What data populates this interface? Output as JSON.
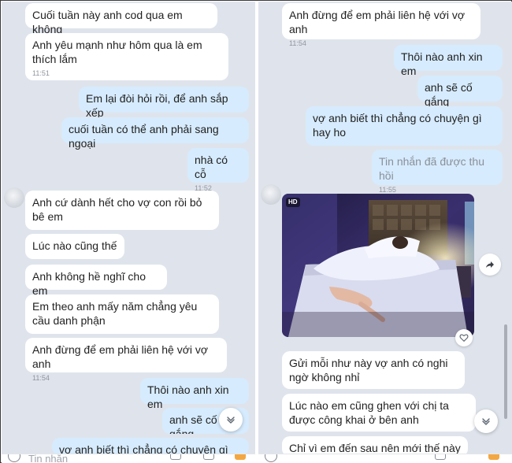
{
  "left_panel": {
    "messages": [
      {
        "text": "Cuối tuần này anh cod qua em không",
        "time": ""
      },
      {
        "text": "Anh yêu mạnh như hôm qua là em thích lắm",
        "time": "11:51"
      },
      {
        "text": "Em lại đòi hỏi rồi, để anh sắp xếp",
        "time": ""
      },
      {
        "text": "cuối tuần có thể anh phải sang ngoại",
        "time": ""
      },
      {
        "text": "nhà có cỗ",
        "time": "11:52"
      },
      {
        "text": "Anh cứ dành hết cho vợ con rồi bỏ bê em",
        "time": ""
      },
      {
        "text": "Lúc nào cũng thế",
        "time": ""
      },
      {
        "text": "Anh không hề nghĩ cho em",
        "time": ""
      },
      {
        "text": "Em theo anh mấy năm chẳng yêu cầu danh phận",
        "time": ""
      },
      {
        "text": "Anh đừng để em phải liên hệ với vợ anh",
        "time": "11:54"
      },
      {
        "text": "Thôi nào anh xin em",
        "time": ""
      },
      {
        "text": "anh sẽ cố gắng",
        "time": ""
      },
      {
        "text": "vợ anh biết thì chẳng có chuyện gì hay ho",
        "time": ""
      }
    ],
    "input_placeholder": "Tin nhắn"
  },
  "right_panel": {
    "messages": [
      {
        "text": "Anh đừng để em phải liên hệ với vợ anh",
        "time": "11:54"
      },
      {
        "text": "Thôi nào anh xin em",
        "time": ""
      },
      {
        "text": "anh sẽ cố gắng",
        "time": ""
      },
      {
        "text": "vợ anh biết thì chẳng có chuyện gì hay ho",
        "time": ""
      },
      {
        "text": "Tin nhắn đã được thu hồi",
        "time": "11:55"
      },
      {
        "text": "Gửi mỗi như này vợ anh có nghi ngờ không nhỉ",
        "time": ""
      },
      {
        "text": "Lúc nào em cũng ghen với chị ta được công khai ở bên anh",
        "time": ""
      },
      {
        "text": "Chỉ vì em đến sau nên mới thế này à",
        "time": ""
      }
    ],
    "photo_badge": "HD"
  },
  "colors": {
    "chat_background": "#dfe4ec",
    "received_bubble": "#ffffff",
    "sent_bubble": "#d6ebfd",
    "timestamp": "#8f959e",
    "recalled_text": "#8a9099"
  },
  "icons": [
    "avatar",
    "chevron-down-icon",
    "share-arrow-icon",
    "heart-icon",
    "emoji-icon"
  ]
}
